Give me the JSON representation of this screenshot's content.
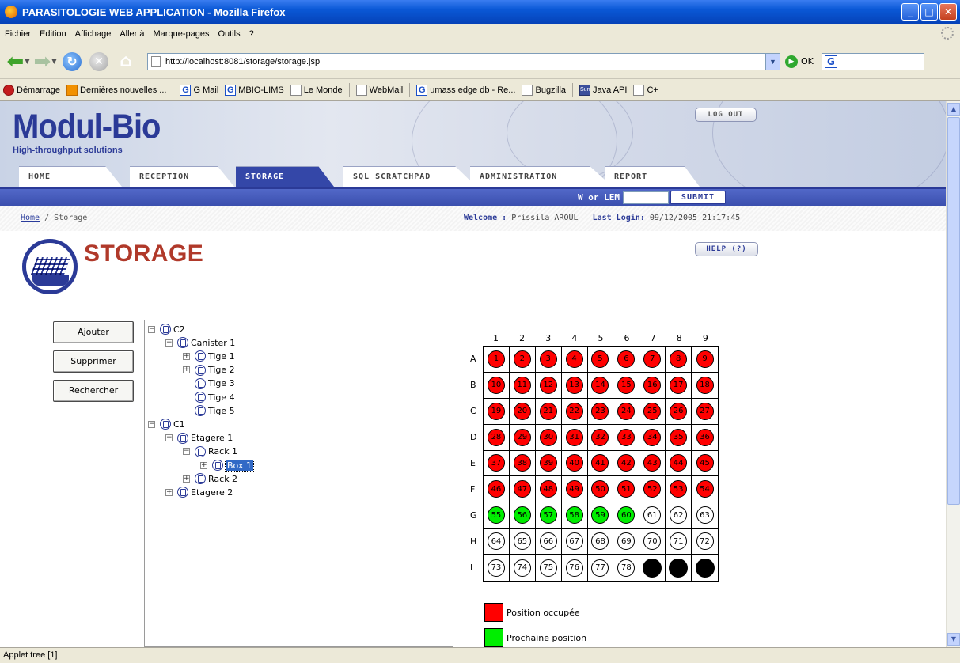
{
  "window": {
    "title": "PARASITOLOGIE WEB APPLICATION - Mozilla Firefox",
    "controls": [
      "_",
      "□",
      "✕"
    ]
  },
  "menu": [
    "Fichier",
    "Edition",
    "Affichage",
    "Aller à",
    "Marque-pages",
    "Outils",
    "?"
  ],
  "toolbar": {
    "url": "http://localhost:8081/storage/storage.jsp",
    "go_label": "OK",
    "search_placeholder": ""
  },
  "bookmarks": [
    {
      "label": "Démarrage",
      "icon": "start-icon"
    },
    {
      "label": "Dernières nouvelles ...",
      "icon": "rss-icon"
    },
    {
      "label": "G Mail",
      "icon": "google-icon"
    },
    {
      "label": "MBIO-LIMS",
      "icon": "google-icon"
    },
    {
      "label": "Le Monde",
      "icon": "page-icon"
    },
    {
      "label": "WebMail",
      "icon": "page-icon"
    },
    {
      "label": "umass edge db - Re...",
      "icon": "google-icon"
    },
    {
      "label": "Bugzilla",
      "icon": "page-icon"
    },
    {
      "label": "Java API",
      "icon": "sun-icon"
    },
    {
      "label": "C+",
      "icon": "page-icon"
    }
  ],
  "site": {
    "logo_name": "Modul-Bio",
    "logo_tag": "High-throughput solutions",
    "logout_label": "LOG OUT",
    "tabs": [
      "HOME",
      "RECEPTION",
      "STORAGE",
      "SQL SCRATCHPAD",
      "ADMINISTRATION",
      "REPORT"
    ],
    "active_tab": "STORAGE",
    "lem_label": "W or LEM",
    "lem_value": "",
    "submit_label": "SUBMIT"
  },
  "breadcrumb": {
    "home": "Home",
    "separator": " / ",
    "current": "Storage",
    "welcome_label": "Welcome :",
    "user": "Prissila AROUL",
    "last_login_label": "Last Login:",
    "last_login": "09/12/2005 21:17:45"
  },
  "page": {
    "title": "STORAGE",
    "help_label": "HELP (?)"
  },
  "actions": [
    "Ajouter",
    "Supprimer",
    "Rechercher"
  ],
  "tree": [
    {
      "label": "C2",
      "depth": 0,
      "expander": "−"
    },
    {
      "label": "Canister 1",
      "depth": 1,
      "expander": "−"
    },
    {
      "label": "Tige 1",
      "depth": 2,
      "expander": "+"
    },
    {
      "label": "Tige 2",
      "depth": 2,
      "expander": "+"
    },
    {
      "label": "Tige 3",
      "depth": 2,
      "expander": ""
    },
    {
      "label": "Tige 4",
      "depth": 2,
      "expander": ""
    },
    {
      "label": "Tige 5",
      "depth": 2,
      "expander": ""
    },
    {
      "label": "C1",
      "depth": 0,
      "expander": "−"
    },
    {
      "label": "Etagere 1",
      "depth": 1,
      "expander": "−"
    },
    {
      "label": "Rack 1",
      "depth": 2,
      "expander": "−"
    },
    {
      "label": "Box 1",
      "depth": 3,
      "expander": "+",
      "selected": true
    },
    {
      "label": "Rack 2",
      "depth": 2,
      "expander": "+"
    },
    {
      "label": "Etagere 2",
      "depth": 1,
      "expander": "+"
    }
  ],
  "plate": {
    "columns": [
      "1",
      "2",
      "3",
      "4",
      "5",
      "6",
      "7",
      "8",
      "9"
    ],
    "rows": [
      "A",
      "B",
      "C",
      "D",
      "E",
      "F",
      "G",
      "H",
      "I"
    ],
    "occupied_through": 54,
    "next_positions": [
      55,
      56,
      57,
      58,
      59,
      60
    ],
    "blocked_positions": [
      79,
      80,
      81
    ],
    "colors": {
      "occupied": "#ff0000",
      "next": "#00ee00",
      "free": "#ffffff",
      "blocked": "#000000"
    }
  },
  "legend": [
    {
      "label": "Position occupée",
      "color": "#ff0000"
    },
    {
      "label": "Prochaine position",
      "color": "#00ee00"
    }
  ],
  "status": "Applet tree [1]"
}
